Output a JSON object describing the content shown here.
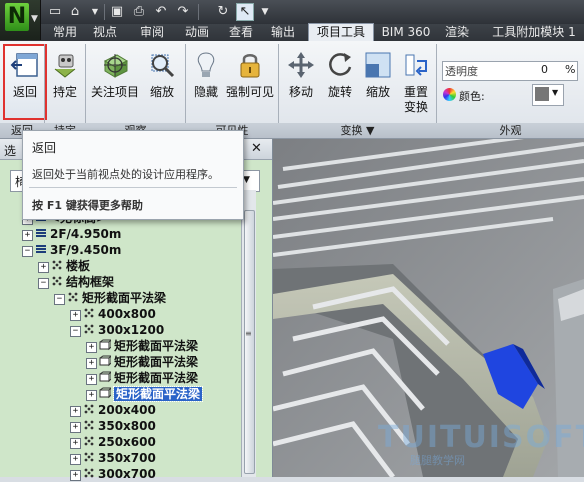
{
  "app": {
    "logo_letter": "N"
  },
  "tabs": [
    "常用",
    "视点",
    "审阅",
    "动画",
    "查看",
    "输出",
    "项目工具",
    "BIM 360",
    "渲染",
    "工具附加模块 1"
  ],
  "active_tab": "项目工具",
  "ribbon": {
    "buttons": {
      "back": "返回",
      "hold": "持定",
      "focus_item": "关注项目",
      "zoom": "缩放",
      "hide": "隐藏",
      "force_visible": "强制可见",
      "move": "移动",
      "rotate": "旋转",
      "scale": "缩放",
      "reset": "重置",
      "transform": "变换"
    },
    "appearance": {
      "transparency_label": "透明度",
      "transparency_value": "0",
      "transparency_unit": "%",
      "color_label": "颜色:"
    },
    "group_labels": {
      "back": "返回",
      "hold": "持定",
      "observe": "观察",
      "visibility": "可见性",
      "transform": "变换 ▼",
      "appearance": "外观"
    }
  },
  "tooltip": {
    "title": "返回",
    "description": "返回处于当前视点处的设计应用程序。",
    "help": "按 F1 键获得更多帮助"
  },
  "browser": {
    "title_partial": "选",
    "close_label": "✕",
    "combo_value": "椅",
    "rows": [
      {
        "label": "<无标高>",
        "depth": 1,
        "icon": "level"
      },
      {
        "label": "2F/4.950m",
        "depth": 1,
        "icon": "level"
      },
      {
        "label": "3F/9.450m",
        "depth": 1,
        "icon": "level"
      },
      {
        "label": "楼板",
        "depth": 2,
        "icon": "category"
      },
      {
        "label": "结构框架",
        "depth": 2,
        "icon": "category"
      },
      {
        "label": "矩形截面平法梁",
        "depth": 3,
        "icon": "category"
      },
      {
        "label": "400x800",
        "depth": 4,
        "icon": "category"
      },
      {
        "label": "300x1200",
        "depth": 4,
        "icon": "category"
      },
      {
        "label": "矩形截面平法梁",
        "depth": 5,
        "icon": "instance"
      },
      {
        "label": "矩形截面平法梁",
        "depth": 5,
        "icon": "instance"
      },
      {
        "label": "矩形截面平法梁",
        "depth": 5,
        "icon": "instance"
      },
      {
        "label": "矩形截面平法梁",
        "depth": 5,
        "icon": "instance",
        "selected": true
      },
      {
        "label": "200x400",
        "depth": 4,
        "icon": "category"
      },
      {
        "label": "350x800",
        "depth": 4,
        "icon": "category"
      },
      {
        "label": "250x600",
        "depth": 4,
        "icon": "category"
      },
      {
        "label": "350x700",
        "depth": 4,
        "icon": "category"
      },
      {
        "label": "300x700",
        "depth": 4,
        "icon": "category"
      }
    ]
  },
  "watermark": {
    "text": "TUITUISOFT",
    "sub": "腿腿教学网"
  },
  "colors": {
    "accent_green": "#2f8f19",
    "selection_blue": "#2a63c8",
    "highlight_red": "#e0322f"
  }
}
